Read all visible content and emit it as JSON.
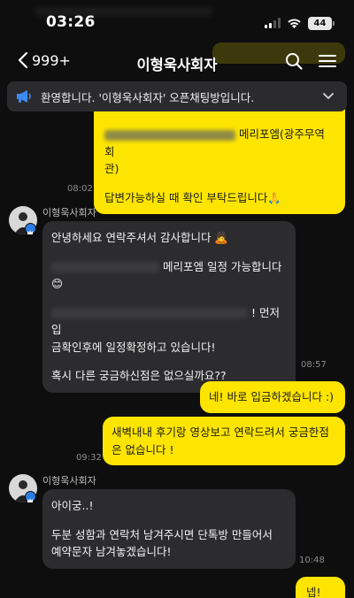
{
  "status_bar": {
    "time": "03:26",
    "battery": "44"
  },
  "nav": {
    "back_count": "999+",
    "title": "이형욱사회자"
  },
  "notice": {
    "text": "환영합니다. '이형욱사회자' 오픈채팅방입니다."
  },
  "messages": {
    "m1": {
      "line1_tail": "메리포엠(광주무역회",
      "line1_wrap": "관)",
      "line2": "답변가능하실 때 확인 부탁드립니다🙏",
      "time": "08:02"
    },
    "m2": {
      "sender": "이형욱사회자",
      "p1": "안녕하세요 연락주셔서 감사합니다 🙇",
      "p2_tail": "메리포엠 일정 가능합니다",
      "p2_emoji": "😊",
      "p3_tail": "! 먼저 입",
      "p3_wrap": "금확인후에 일정확정하고 있습니다!",
      "p4": "혹시 다른 궁금하신점은 없으실까요??",
      "time": "08:57"
    },
    "m3": {
      "text": "네! 바로 입금하겠습니다 :)"
    },
    "m4": {
      "line1": "새벽내내 후기랑 영상보고 연락드려서 궁금한점",
      "line2": "은 없습니다 !",
      "time": "09:32"
    },
    "m5": {
      "sender": "이형욱사회자",
      "p1": "아이궁..!",
      "p2_line1": "두분 성함과 연락처 남겨주시면 단톡방 만들어서",
      "p2_line2": "예약문자 남겨놓겠습니다!",
      "time": "10:48"
    },
    "m6": {
      "text": "넵!"
    }
  },
  "colors": {
    "my_bubble": "#fee500",
    "their_bubble": "#2c2c2e",
    "background": "#0e0e0f"
  }
}
